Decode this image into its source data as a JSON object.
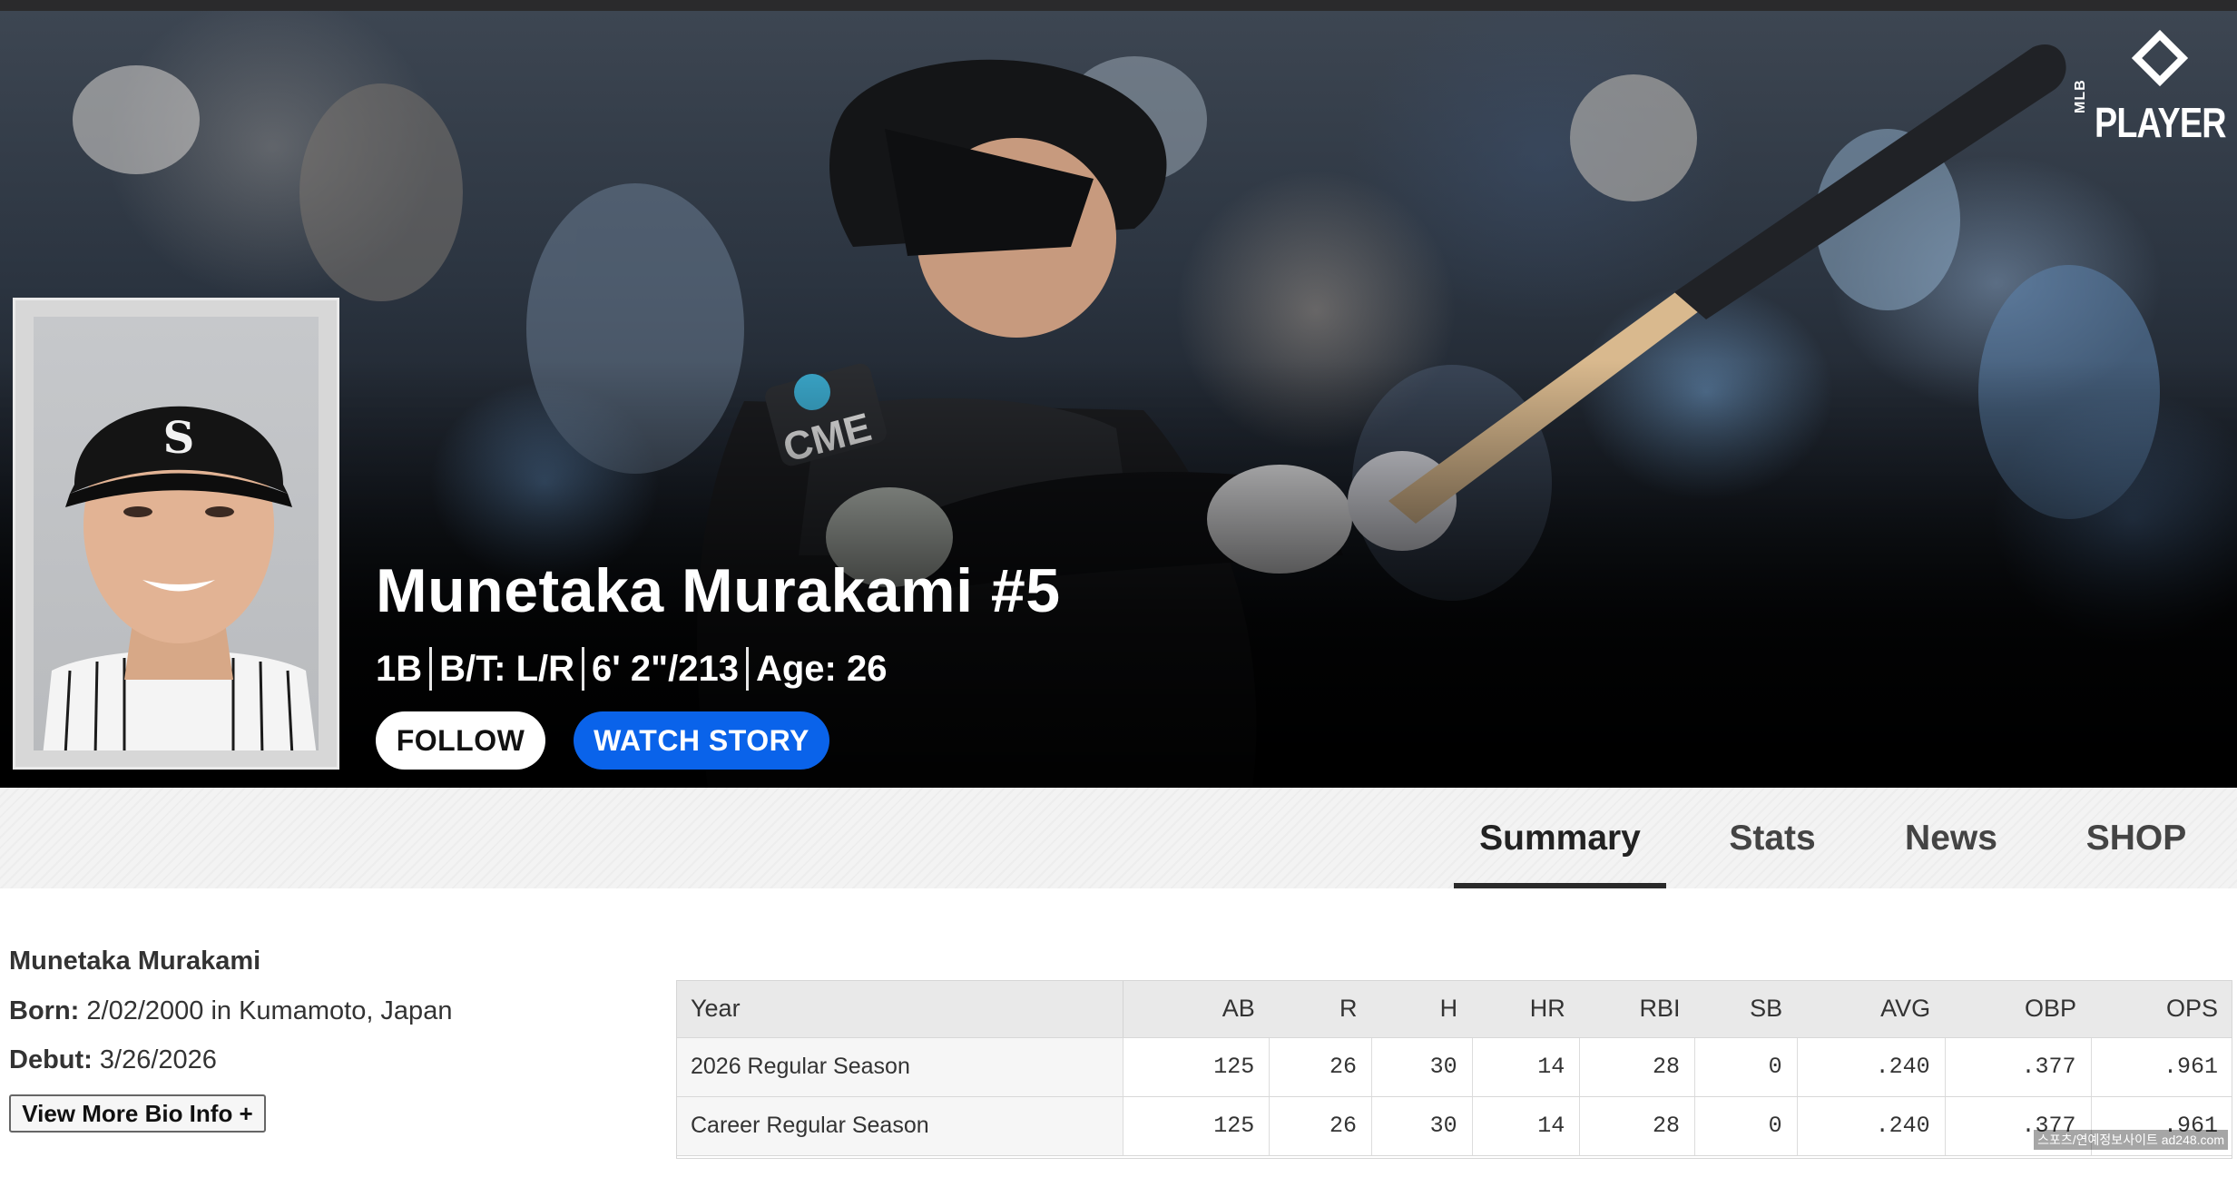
{
  "hero": {
    "logo_small": "MLB",
    "logo_word": "PLAYER",
    "name": "Munetaka Murakami #5",
    "position": "1B",
    "bats_throws": "B/T: L/R",
    "height_weight": "6' 2\"/213",
    "age": "Age: 26",
    "follow_label": "FOLLOW",
    "watch_label": "WATCH STORY",
    "jersey_logo": "CME"
  },
  "tabs": [
    {
      "label": "Summary",
      "active": true
    },
    {
      "label": "Stats",
      "active": false
    },
    {
      "label": "News",
      "active": false
    },
    {
      "label": "SHOP",
      "active": false
    }
  ],
  "bio": {
    "full_name": "Munetaka Murakami",
    "born_label": "Born:",
    "born_value": "2/02/2000 in Kumamoto, Japan",
    "debut_label": "Debut:",
    "debut_value": "3/26/2026",
    "more_button": "View More Bio Info +"
  },
  "stats": {
    "headers": [
      "Year",
      "AB",
      "R",
      "H",
      "HR",
      "RBI",
      "SB",
      "AVG",
      "OBP",
      "OPS"
    ],
    "rows": [
      [
        "2026 Regular Season",
        "125",
        "26",
        "30",
        "14",
        "28",
        "0",
        ".240",
        ".377",
        ".961"
      ],
      [
        "Career Regular Season",
        "125",
        "26",
        "30",
        "14",
        "28",
        "0",
        ".240",
        ".377",
        ".961"
      ]
    ]
  },
  "watermark": "스포츠/연예정보사이트 ad248.com",
  "colors": {
    "accent_blue": "#0a63ea",
    "hero_dark": "#000000",
    "tab_underline": "#2a2a2a"
  }
}
